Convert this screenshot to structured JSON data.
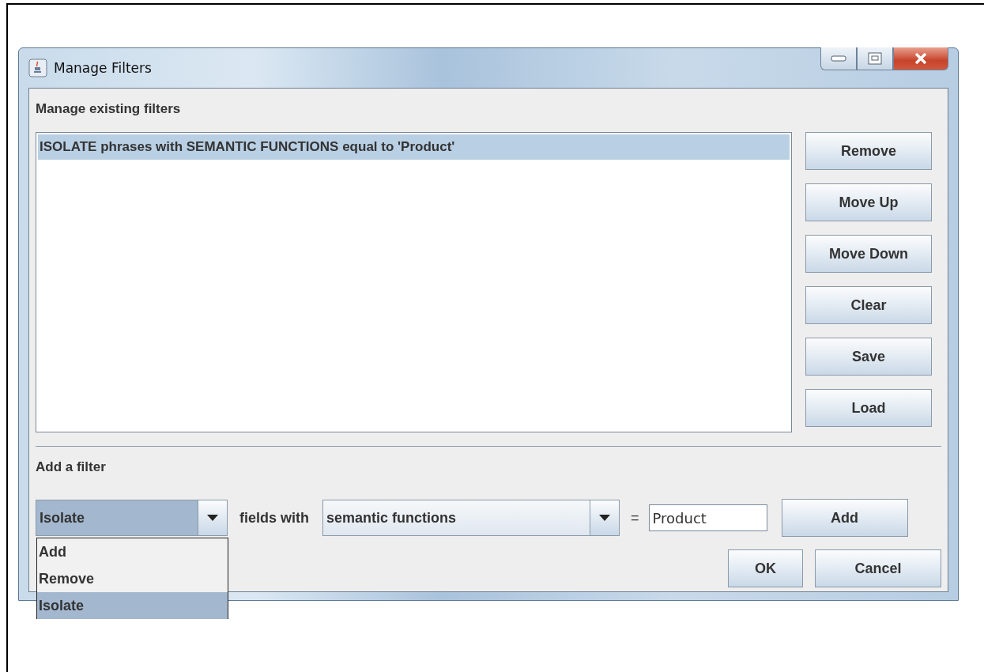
{
  "window": {
    "title": "Manage Filters"
  },
  "existing": {
    "heading": "Manage existing filters",
    "filters": [
      {
        "text": "ISOLATE phrases with SEMANTIC FUNCTIONS equal to 'Product'",
        "selected": true
      }
    ],
    "buttons": [
      "Remove",
      "Move Up",
      "Move Down",
      "Clear",
      "Save",
      "Load"
    ]
  },
  "add_filter": {
    "heading": "Add a filter",
    "action_combo": {
      "value": "Isolate",
      "expanded": true,
      "options": [
        {
          "label": "Add",
          "selected": false
        },
        {
          "label": "Remove",
          "selected": false
        },
        {
          "label": "Isolate",
          "selected": true
        }
      ]
    },
    "fields_label": "fields with",
    "field_combo": {
      "value": "semantic functions"
    },
    "equals": "=",
    "value_input": {
      "value": "Product"
    },
    "add_button": "Add"
  },
  "footer": {
    "buttons": [
      "OK",
      "Cancel"
    ]
  }
}
